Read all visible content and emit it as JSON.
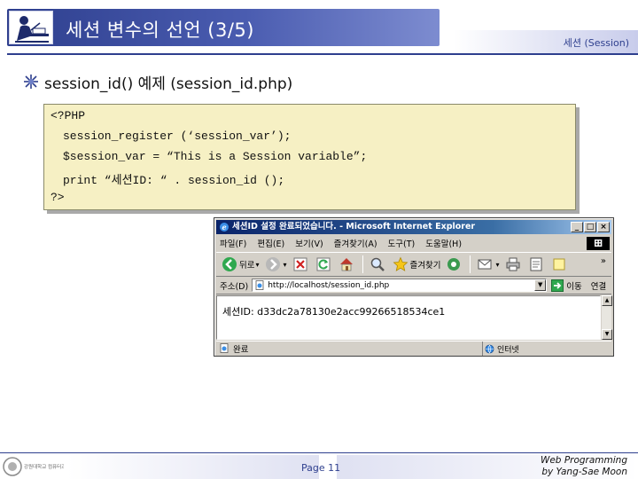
{
  "header": {
    "title": "세션 변수의 선언 (3/5)",
    "section_tag": "세션 (Session)",
    "logo_icon": "person-writing-icon"
  },
  "heading": {
    "text": "session_id() 예제 (session_id.php)",
    "bullet_icon": "star-bullet-icon"
  },
  "code": {
    "lines": [
      "<?PHP",
      "session_register (‘session_var’);",
      "$session_var = “This is a Session variable”;",
      "print “세션ID: “ . session_id ();",
      "?>"
    ],
    "background": "#f6f0c4"
  },
  "browser": {
    "title": "세션ID 설정 완료되었습니다. - Microsoft Internet Explorer",
    "window_buttons": [
      "_",
      "□",
      "×"
    ],
    "menu": [
      "파일(F)",
      "편집(E)",
      "보기(V)",
      "즐겨찾기(A)",
      "도구(T)",
      "도움말(H)"
    ],
    "toolbar": {
      "back_label": "뒤로",
      "favorites_label": "즐겨찾기",
      "more": "»"
    },
    "address": {
      "label": "주소(D)",
      "url": "http://localhost/session_id.php",
      "go_label": "이동",
      "links_label": "연결"
    },
    "content_text": "세션ID: d33dc2a78130e2acc99266518534ce1",
    "status": {
      "left": "완료",
      "zone": "인터넷"
    }
  },
  "footer": {
    "page": "Page 11",
    "course_line1": "Web Programming",
    "course_line2": "by Yang-Sae Moon",
    "logo_text": "강원대학교 컴퓨터과학과"
  },
  "colors": {
    "accent": "#2e3f8e",
    "title_bar": "#0a246a",
    "window_face": "#d4d0c8"
  }
}
